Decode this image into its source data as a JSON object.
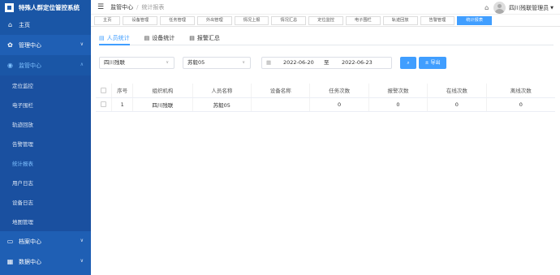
{
  "app": {
    "title": "特殊人群定位管控系统"
  },
  "sidebar": {
    "items": [
      {
        "label": "主页",
        "icon": "home-icon"
      },
      {
        "label": "管理中心",
        "icon": "gear-icon"
      },
      {
        "label": "监管中心",
        "icon": "location-pin-icon"
      },
      {
        "label": "档案中心",
        "icon": "folder-icon"
      },
      {
        "label": "数据中心",
        "icon": "grid-icon"
      }
    ],
    "sub_items": [
      "定位监控",
      "电子围栏",
      "轨迹回放",
      "告警管理",
      "统计报表",
      "用户日志",
      "设备日志",
      "地图管理"
    ]
  },
  "header": {
    "breadcrumb": [
      "监管中心",
      "统计报表"
    ],
    "user": "四川残联管理员"
  },
  "tags": [
    "主页",
    "设备管理",
    "任务管理",
    "外出管理",
    "情况上报",
    "情况汇总",
    "定位监控",
    "电子围栏",
    "轨迹回放",
    "告警管理",
    "统计报表"
  ],
  "subtabs": [
    "人员统计",
    "设备统计",
    "报警汇总"
  ],
  "filters": {
    "org": "四川残联",
    "person": "苏毅05",
    "start_date": "2022-06-20",
    "to_label": "至",
    "end_date": "2022-06-23",
    "export_label": "导出"
  },
  "table": {
    "columns": [
      "序号",
      "组织机构",
      "人员名称",
      "设备名称",
      "任务次数",
      "报警次数",
      "在线次数",
      "离线次数"
    ],
    "rows": [
      [
        "1",
        "四川残联",
        "苏毅05",
        "",
        "0",
        "0",
        "0",
        "0"
      ]
    ]
  },
  "colors": {
    "sidebar": "#1f5fb4",
    "accent": "#409eff"
  }
}
